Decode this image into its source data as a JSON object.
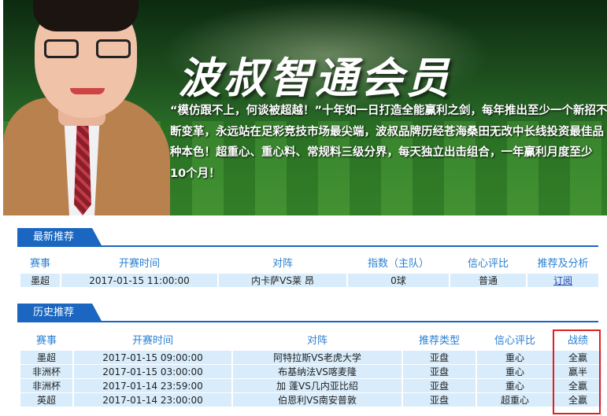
{
  "banner": {
    "title": "波叔智通会员",
    "description": "“模仿跟不上，何谈被超越！”十年如一日打造全能赢利之剑，每年推出至少一个新招不断变革，永远站在足彩竞技市场最尖端，波叔品牌历经苍海桑田无改中长线投资最佳品种本色！超重心、重心料、常规料三级分界，每天独立出击组合，一年赢利月度至少10个月！"
  },
  "latest": {
    "tab_label": "最新推荐",
    "headers": [
      "赛事",
      "开赛时间",
      "对阵",
      "指数（主队）",
      "信心评比",
      "推荐及分析"
    ],
    "rows": [
      {
        "league": "墨超",
        "time": "2017-01-15 11:00:00",
        "match": "内卡萨VS莱 昂",
        "index": "0球",
        "confidence": "普通",
        "action": "订阅"
      }
    ]
  },
  "history": {
    "tab_label": "历史推荐",
    "headers": [
      "赛事",
      "开赛时间",
      "对阵",
      "推荐类型",
      "信心评比",
      "战绩"
    ],
    "rows": [
      {
        "league": "墨超",
        "time": "2017-01-15 09:00:00",
        "match": "阿特拉斯VS老虎大学",
        "type": "亚盘",
        "confidence": "重心",
        "result": "全赢"
      },
      {
        "league": "非洲杯",
        "time": "2017-01-15 03:00:00",
        "match": "布基纳法VS喀麦隆",
        "type": "亚盘",
        "confidence": "重心",
        "result": "赢半"
      },
      {
        "league": "非洲杯",
        "time": "2017-01-14 23:59:00",
        "match": "加 蓬VS几内亚比绍",
        "type": "亚盘",
        "confidence": "重心",
        "result": "全赢"
      },
      {
        "league": "英超",
        "time": "2017-01-14 23:00:00",
        "match": "伯恩利VS南安普敦",
        "type": "亚盘",
        "confidence": "超重心",
        "result": "全赢"
      }
    ]
  },
  "colors": {
    "accent": "#1a66c0",
    "header_text": "#2a7fd1",
    "cell_bg": "#d8ecfb",
    "highlight": "#e02020"
  }
}
